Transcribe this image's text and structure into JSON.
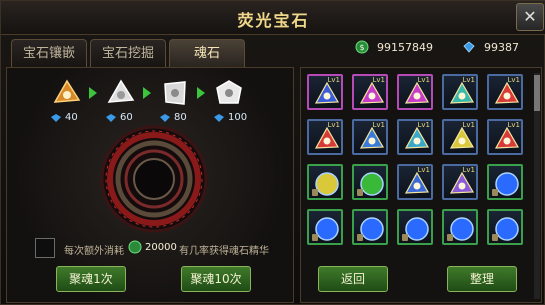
{
  "window": {
    "title": "荧光宝石"
  },
  "close": {
    "icon": "close-x-icon",
    "glyph": "✕"
  },
  "tabs": [
    {
      "label": "宝石镶嵌",
      "active": false
    },
    {
      "label": "宝石挖掘",
      "active": false
    },
    {
      "label": "魂石",
      "active": true
    }
  ],
  "currency": {
    "gold": {
      "value": "99157849",
      "icon": "green-gem-icon",
      "color": "#3cc45a"
    },
    "diamond": {
      "value": "99387",
      "icon": "blue-diamond-icon",
      "color": "#4aa8ff"
    }
  },
  "upgrade_chain": {
    "stones": [
      {
        "icon": "orange-soul-stone-icon",
        "cost": "40",
        "color": "#e8a838"
      },
      {
        "icon": "white-soul-stone-icon",
        "cost": "60",
        "color": "#e8e8e8"
      },
      {
        "icon": "white-soul-stone-icon",
        "cost": "80",
        "color": "#e8e8e8"
      },
      {
        "icon": "white-soul-stone-icon",
        "cost": "100",
        "color": "#f0f0f0"
      }
    ],
    "arrow_color": "#3cc43c"
  },
  "extra_cost": {
    "prefix": "每次额外消耗",
    "amount": "20000",
    "suffix": "有几率获得魂石精华"
  },
  "buttons": {
    "gather_once": "聚魂1次",
    "gather_ten": "聚魂10次",
    "back": "返回",
    "sort": "整理"
  },
  "inventory": {
    "level_label": "Lv1",
    "slots": [
      {
        "color": "#3a5cd8",
        "border": "purple"
      },
      {
        "color": "#c83ac8",
        "border": "purple"
      },
      {
        "color": "#c83ac8",
        "border": "purple"
      },
      {
        "color": "#3ab8a8",
        "border": "blue"
      },
      {
        "color": "#d83a3a",
        "border": "blue"
      },
      {
        "color": "#d83a3a",
        "border": "blue"
      },
      {
        "color": "#3a7ad8",
        "border": "blue"
      },
      {
        "color": "#3aa8c8",
        "border": "blue"
      },
      {
        "color": "#d8c83a",
        "border": "blue"
      },
      {
        "color": "#d83a3a",
        "border": "blue"
      },
      {
        "color": "#d8c83a",
        "border": "green"
      },
      {
        "color": "#3ab83a",
        "border": "green"
      },
      {
        "color": "#3a6ad8",
        "border": "blue"
      },
      {
        "color": "#8a5ad8",
        "border": "blue"
      },
      {
        "color": "#2a6aff",
        "border": "green"
      },
      {
        "color": "#2a6aff",
        "border": "green"
      },
      {
        "color": "#2a6aff",
        "border": "green"
      },
      {
        "color": "#2a6aff",
        "border": "green"
      },
      {
        "color": "#2a6aff",
        "border": "green"
      },
      {
        "color": "#2a6aff",
        "border": "green"
      }
    ]
  }
}
